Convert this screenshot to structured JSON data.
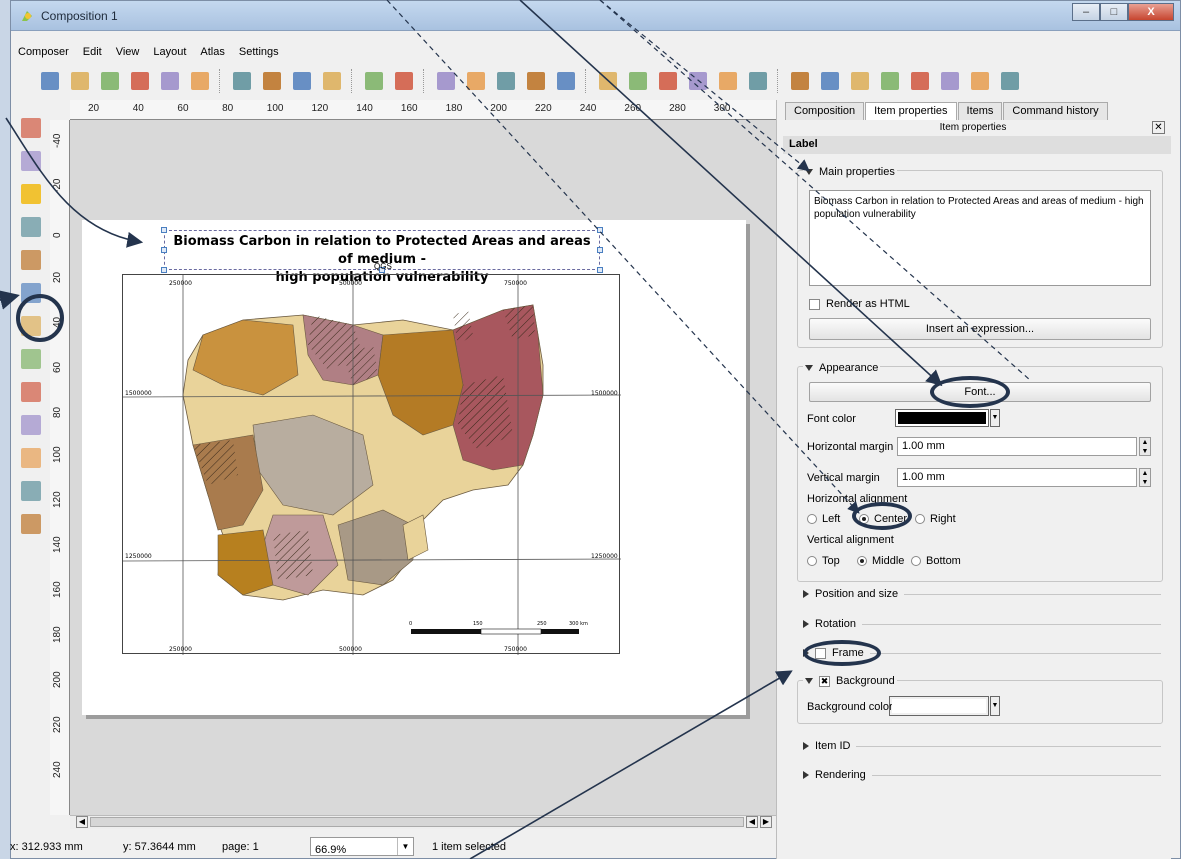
{
  "window": {
    "title": "Composition 1",
    "minimize": "–",
    "maximize": "□",
    "close": "X"
  },
  "menu": [
    "Composer",
    "Edit",
    "View",
    "Layout",
    "Atlas",
    "Settings"
  ],
  "toolbar_icons": [
    "save-icon",
    "new-composer-icon",
    "duplicate-composer-icon",
    "composer-manager-icon",
    "open-template-icon",
    "save-template-icon",
    "print-icon",
    "export-image-icon",
    "export-svg-icon",
    "export-pdf-icon",
    "undo-icon",
    "redo-icon",
    "zoom-full-icon",
    "zoom-100-icon",
    "zoom-in-icon",
    "zoom-out-icon",
    "refresh-icon",
    "select-all-icon",
    "zoom-to-item-icon",
    "lock-icon",
    "unlock-icon",
    "group-icon",
    "ungroup-icon",
    "atlas-preview-icon",
    "first-feature-icon",
    "previous-feature-icon",
    "next-feature-icon",
    "last-feature-icon",
    "atlas-print-icon",
    "atlas-export-icon",
    "atlas-settings-icon"
  ],
  "left_tools": [
    "pan-icon",
    "zoom-tool-icon",
    "select-move-icon",
    "move-content-icon",
    "add-map-icon",
    "add-image-icon",
    "add-label-icon",
    "add-legend-icon",
    "add-scalebar-icon",
    "add-shape-icon",
    "add-arrow-icon",
    "add-table-icon",
    "add-html-icon"
  ],
  "ruler_top": [
    "20",
    "40",
    "60",
    "80",
    "100",
    "120",
    "140",
    "160",
    "180",
    "200",
    "220",
    "240",
    "260",
    "280",
    "300"
  ],
  "ruler_left": [
    "-40",
    "-20",
    "0",
    "20",
    "40",
    "60",
    "80",
    "100",
    "120",
    "140",
    "160",
    "180",
    "200",
    "220",
    "240"
  ],
  "map": {
    "title_line1": "Biomass Carbon in relation to Protected Areas and areas of medium -",
    "title_line2": "high population vulnerability",
    "qgs": "QGS",
    "grid_top": [
      "250000",
      "500000",
      "750000"
    ],
    "grid_bottom": [
      "250000",
      "500000",
      "750000"
    ],
    "grid_left": [
      "1500000",
      "1250000"
    ],
    "grid_right": [
      "1500000",
      "1250000"
    ],
    "scalebar_labels": [
      "0",
      "150",
      "250",
      "300 km"
    ]
  },
  "status": {
    "x": "x: 312.933 mm",
    "y": "y: 57.3644 mm",
    "page": "page: 1",
    "zoom": "66.9%",
    "selection": "1 item selected"
  },
  "panel": {
    "tabs": [
      "Composition",
      "Item properties",
      "Items",
      "Command history"
    ],
    "dock_title": "Item properties",
    "header": "Label",
    "main_properties": "Main properties",
    "label_text": "Biomass Carbon in relation to Protected Areas and areas of medium - high population vulnerability",
    "render_html": "Render as HTML",
    "insert_expression": "Insert an expression...",
    "appearance": "Appearance",
    "font_button": "Font...",
    "font_color": "Font color",
    "h_margin_label": "Horizontal margin",
    "h_margin_value": "1.00 mm",
    "v_margin_label": "Vertical margin",
    "v_margin_value": "1.00 mm",
    "h_align_label": "Horizontal alignment",
    "h_align_options": [
      "Left",
      "Center",
      "Right"
    ],
    "v_align_label": "Vertical alignment",
    "v_align_options": [
      "Top",
      "Middle",
      "Bottom"
    ],
    "position_size": "Position and size",
    "rotation": "Rotation",
    "frame": "Frame",
    "background": "Background",
    "background_color": "Background color",
    "item_id": "Item ID",
    "rendering": "Rendering"
  },
  "colors": {
    "accent": "#24344d",
    "font_color": "#000000",
    "background_color": "#ffffff"
  }
}
